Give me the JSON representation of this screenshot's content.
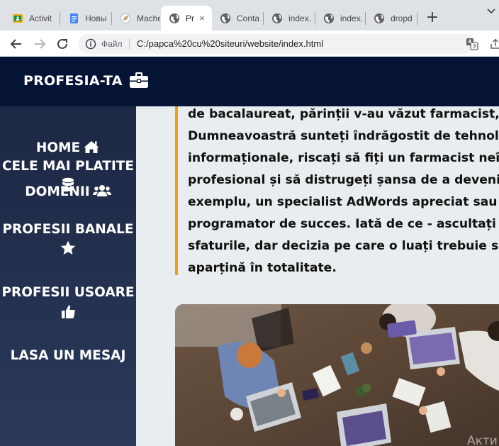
{
  "browser": {
    "tabs": [
      {
        "title": "Activit",
        "icon": "classroom-icon",
        "active": false
      },
      {
        "title": "Новы",
        "icon": "docs-icon",
        "active": false
      },
      {
        "title": "Mache",
        "icon": "leaf-icon",
        "active": false
      },
      {
        "title": "Pr",
        "icon": "globe-icon",
        "active": true
      },
      {
        "title": "Conta",
        "icon": "globe-icon",
        "active": false
      },
      {
        "title": "index.",
        "icon": "globe-icon",
        "active": false
      },
      {
        "title": "index.",
        "icon": "globe-icon",
        "active": false
      },
      {
        "title": "dropd",
        "icon": "globe-icon",
        "active": false
      }
    ],
    "new_tab": "+",
    "close_glyph": "×",
    "address": {
      "scheme_label": "Файл",
      "url": "C:/papca%20cu%20siteuri/website/index.html"
    }
  },
  "site": {
    "brand": "PROFESIA-TA",
    "brand_icon": "briefcase-icon",
    "nav": [
      {
        "label": "HOME",
        "icon": "home-icon"
      },
      {
        "label": "DOMENII",
        "icon": "users-icon"
      },
      {
        "label": "CELE MAI PLATITE",
        "icon": "database-icon"
      },
      {
        "label": "PROFESII BANALE",
        "icon": "star-icon"
      },
      {
        "label": "PROFESII USOARE",
        "icon": "thumbs-up-icon"
      },
      {
        "label": "LASA UN MESAJ",
        "icon": ""
      }
    ],
    "quote_lines": [
      "de bacalaureat, părinții v-au văzut farmacist, iar",
      "Dumneavoastră sunteți îndrăgostit de tehnologiile",
      "informaționale, riscați să fiți un farmacist neîmplinit",
      "profesional și să distrugeți șansa de a deveni , spre",
      "exemplu, un specialist AdWords apreciat sau un",
      "programator de succes. Iată de ce - ascultați toate",
      "sfaturile, dar decizia pe care o luați trebuie să vă",
      "aparțină în totalitate."
    ],
    "photo_icon": "team-meeting-photo",
    "watermark": "Акти"
  },
  "colors": {
    "header_bg": "#051435",
    "sidebar_top": "#1c2743",
    "sidebar_bottom": "#2b3a5b",
    "content_bg": "#e8eef0",
    "accent": "#f29d12"
  }
}
